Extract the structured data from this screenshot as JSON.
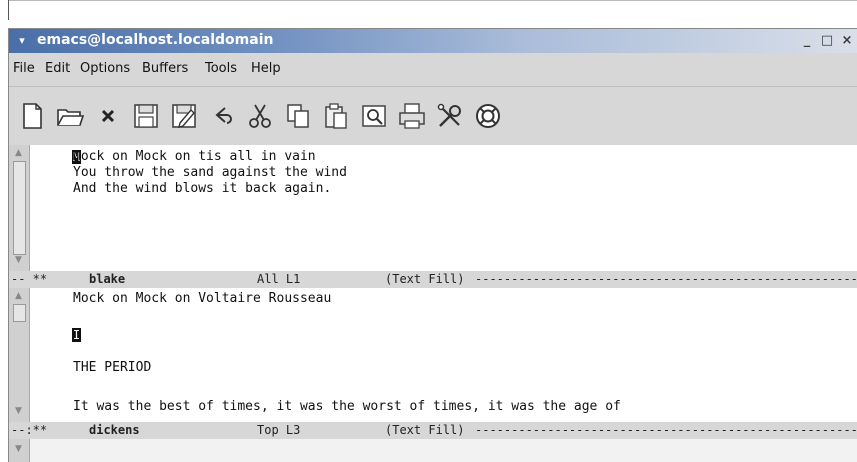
{
  "window": {
    "title": "emacs@localhost.localdomain",
    "min_glyph": "_",
    "max_glyph": "□",
    "close_glyph": "×",
    "menu_glyph": "▾"
  },
  "menubar": {
    "items": [
      "File",
      "Edit",
      "Options",
      "Buffers",
      "Tools",
      "Help"
    ]
  },
  "toolbar": {
    "tools": [
      "new-file-icon",
      "open-folder-icon",
      "close-buffer-icon",
      "save-icon",
      "save-as-icon",
      "undo-icon",
      "cut-icon",
      "copy-icon",
      "paste-icon",
      "search-icon",
      "print-icon",
      "preferences-icon",
      "help-icon"
    ]
  },
  "pane_top": {
    "lines": [
      "Mock on Mock on tis all in vain",
      "You throw the sand against the wind",
      "And the wind blows it back again."
    ],
    "cursor_char": "M"
  },
  "modeline_top": {
    "prefix": "-- **",
    "buffer": "blake",
    "position": "All L1",
    "mode": "(Text Fill)",
    "fill": "--------------------------------------------------------"
  },
  "pane_bottom": {
    "line1": "Mock on Mock on Voltaire Rousseau",
    "cursor_char": "I",
    "line3": "THE PERIOD",
    "line4": "It was the best of times, it was the worst of times, it was the age of"
  },
  "modeline_bottom": {
    "prefix": "--:**",
    "buffer": "dickens",
    "position": "Top L3",
    "mode": "(Text Fill)",
    "fill": "--------------------------------------------------------"
  }
}
